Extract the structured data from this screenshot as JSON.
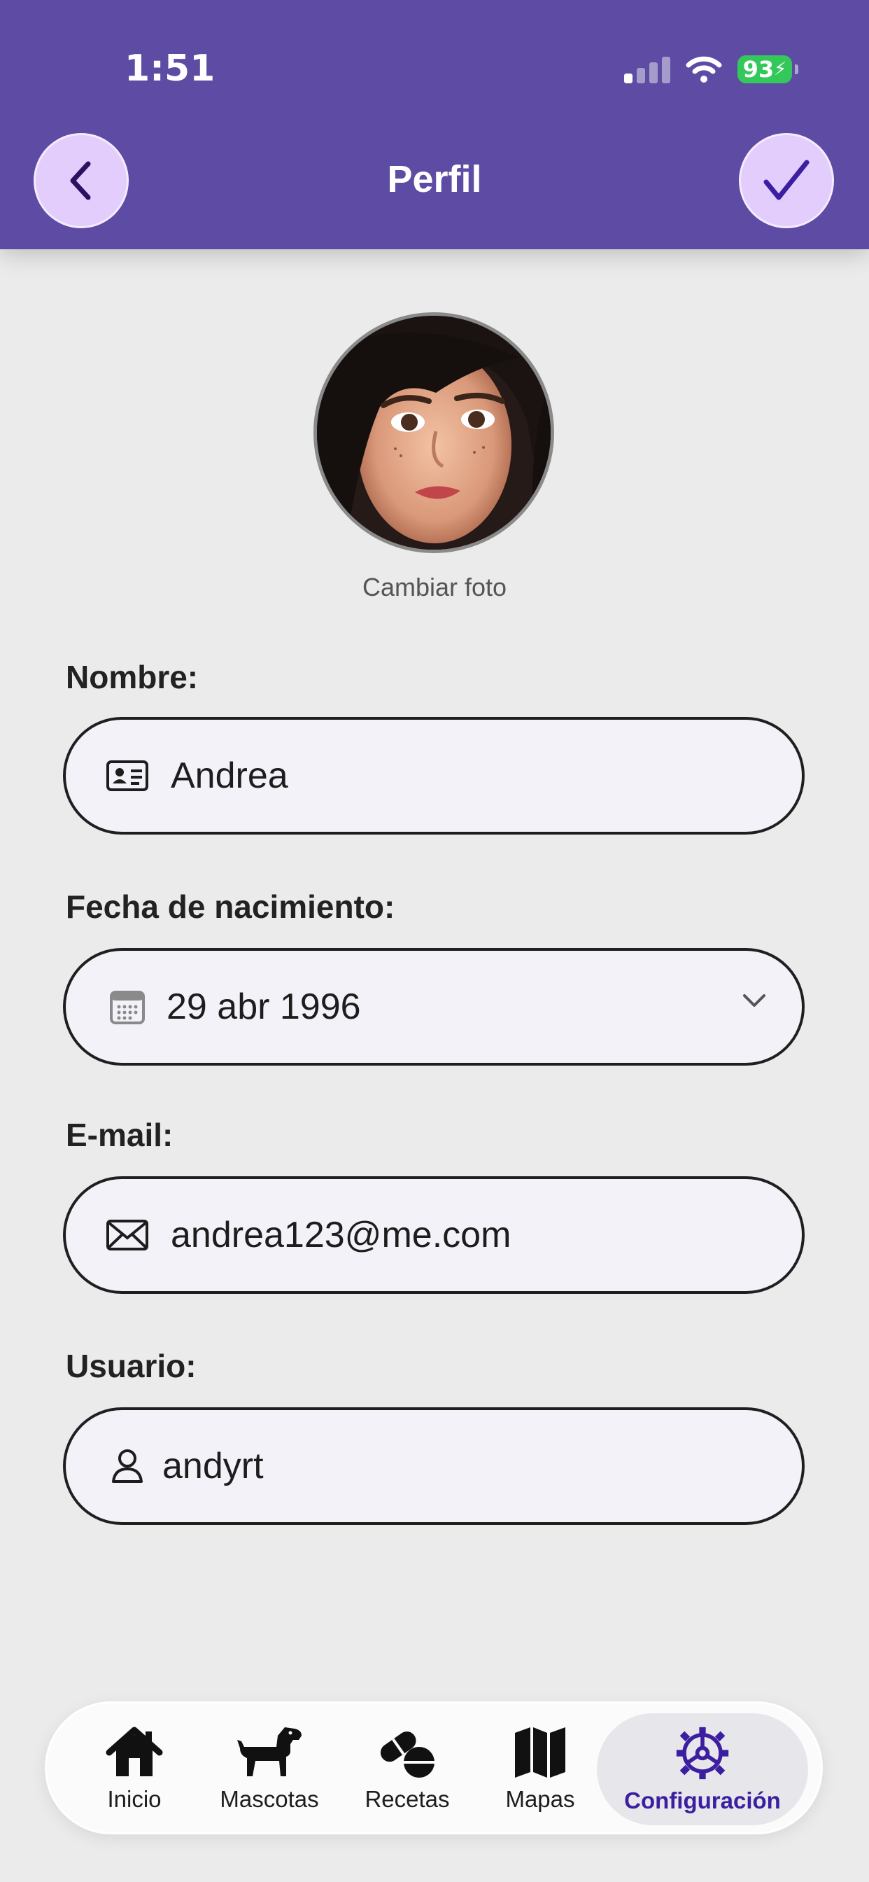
{
  "status_bar": {
    "time": "1:51",
    "battery": "93"
  },
  "header": {
    "title": "Perfil"
  },
  "profile": {
    "change_photo_label": "Cambiar foto"
  },
  "form": {
    "name": {
      "label": "Nombre:",
      "value": "Andrea"
    },
    "birthdate": {
      "label": "Fecha de nacimiento:",
      "value": "29 abr 1996"
    },
    "email": {
      "label": "E-mail:",
      "value": "andrea123@me.com"
    },
    "username": {
      "label": "Usuario:",
      "value": "andyrt"
    }
  },
  "tabbar": {
    "items": [
      {
        "label": "Inicio",
        "icon": "house-icon"
      },
      {
        "label": "Mascotas",
        "icon": "dog-icon"
      },
      {
        "label": "Recetas",
        "icon": "pills-icon"
      },
      {
        "label": "Mapas",
        "icon": "map-icon"
      },
      {
        "label": "Configuración",
        "icon": "gear-icon",
        "active": true
      }
    ]
  },
  "colors": {
    "header": "#5e4ba3",
    "button": "#e3cdfc",
    "accent": "#3b1fa0",
    "battery": "#34c759",
    "field_bg": "#f3f2f8",
    "page_bg": "#ebebeb"
  }
}
